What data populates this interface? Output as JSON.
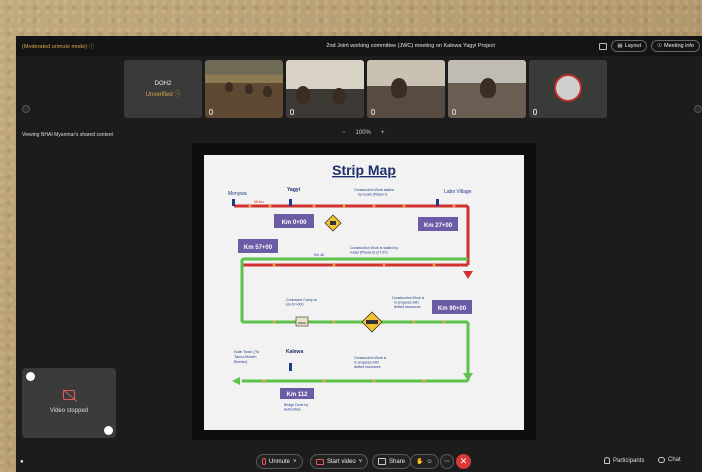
{
  "titlebar": {
    "status": "(Moderated unmute mode) ⓘ",
    "meeting_title": "2nd Joint working committee (JWC) meeting on Kalewa Yagyi Project",
    "layout_label": "Layout",
    "info_label": "Meeting info"
  },
  "participants": {
    "name_tile": {
      "name": "DOH2",
      "status": "Unverified ⓘ"
    }
  },
  "viewbar": {
    "viewing_label": "Viewing NHAI Myanmar's shared content",
    "zoom_out": "−",
    "zoom_level": "100%",
    "zoom_in": "+"
  },
  "strip_map": {
    "title": "Strip Map",
    "monywa": "Monywa",
    "yagyi": "Yagyi",
    "labo_village": "Labo Village",
    "km_68": "68 km",
    "km_000": "Km 0+00",
    "km_2700": "Km 27+00",
    "km_5700": "Km 57+00",
    "km_46": "Km 46",
    "km_9000": "Km 90+00",
    "km_112": "Km 112",
    "kale_town": [
      "Kale Town (To",
      "Tamu-Moreh",
      "Border)"
    ],
    "kalewa": "Kalewa",
    "note_1": [
      "Construction Work stalled",
      "by locals (Phase-I)"
    ],
    "note_2": [
      "Construction Work is stalled by",
      "locals (Phase-II) (37-67)"
    ],
    "note_3": [
      "Contractor Camp at",
      "km 67+000"
    ],
    "note_4": [
      "Construction Work is",
      "in progress with",
      "limited resources"
    ],
    "note_5": [
      "Construction Work is",
      "in progress with",
      "limited resources"
    ],
    "bridge_note": [
      "Bridge Done by",
      "Authorities"
    ]
  },
  "selfview": {
    "label": "Video stopped"
  },
  "controls": {
    "unmute": "Unmute",
    "start_video": "Start video",
    "share": "Share",
    "participants": "Participants",
    "chat": "Chat"
  },
  "colors": {
    "accent": "#d6a64b",
    "end_call": "#d93838",
    "map_purple": "#6b5ca5",
    "map_red": "#d22f2f",
    "map_green": "#5cc24a"
  }
}
